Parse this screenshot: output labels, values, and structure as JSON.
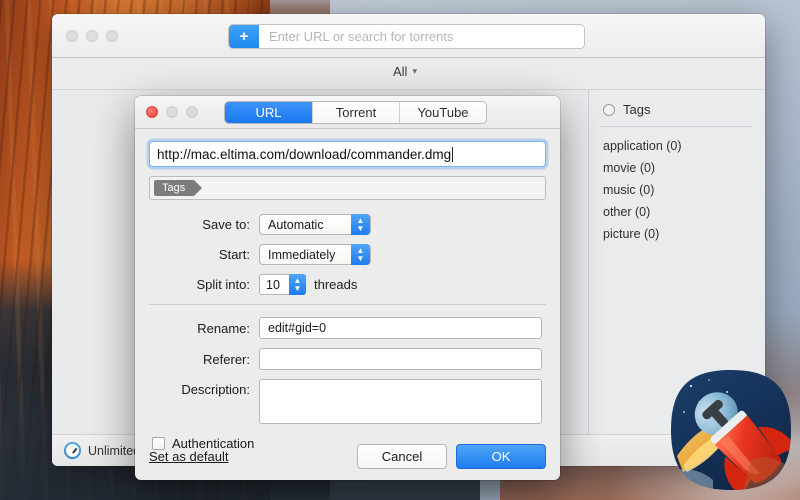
{
  "desktop": {
    "wallpaper_name": "yosemite-wallpaper"
  },
  "main_window": {
    "toolbar": {
      "add_button_label": "+",
      "search_placeholder": "Enter URL or search for torrents",
      "search_value": ""
    },
    "filter": {
      "label": "All",
      "chevron": "⌄"
    },
    "tags_sidebar": {
      "header": "Tags",
      "items": [
        {
          "label": "application (0)"
        },
        {
          "label": "movie (0)"
        },
        {
          "label": "music (0)"
        },
        {
          "label": "other (0)"
        },
        {
          "label": "picture (0)"
        }
      ]
    },
    "statusbar": {
      "speed_label": "Unlimited"
    }
  },
  "dialog": {
    "tabs": [
      {
        "label": "URL",
        "active": true
      },
      {
        "label": "Torrent",
        "active": false
      },
      {
        "label": "YouTube",
        "active": false
      }
    ],
    "url_field": {
      "value": "http://mac.eltima.com/download/commander.dmg",
      "placeholder": ""
    },
    "tags_field": {
      "token_label": "Tags",
      "value": ""
    },
    "save_to": {
      "label": "Save to:",
      "value": "Automatic"
    },
    "start": {
      "label": "Start:",
      "value": "Immediately"
    },
    "split_into": {
      "label": "Split into:",
      "value": "10",
      "suffix": "threads"
    },
    "rename": {
      "label": "Rename:",
      "value": "edit#gid=0"
    },
    "referer": {
      "label": "Referer:",
      "value": ""
    },
    "description": {
      "label": "Description:",
      "value": ""
    },
    "authentication": {
      "label": "Authentication",
      "checked": false
    },
    "set_as_default": {
      "label": "Set as default"
    },
    "cancel_button": {
      "label": "Cancel"
    },
    "ok_button": {
      "label": "OK"
    }
  },
  "colors": {
    "accent_blue": "#1f7cef",
    "accent_blue_light": "#4fa5f8",
    "window_gray": "#ececec",
    "content_gray": "#e8eaec",
    "close_red": "#f24b42"
  }
}
